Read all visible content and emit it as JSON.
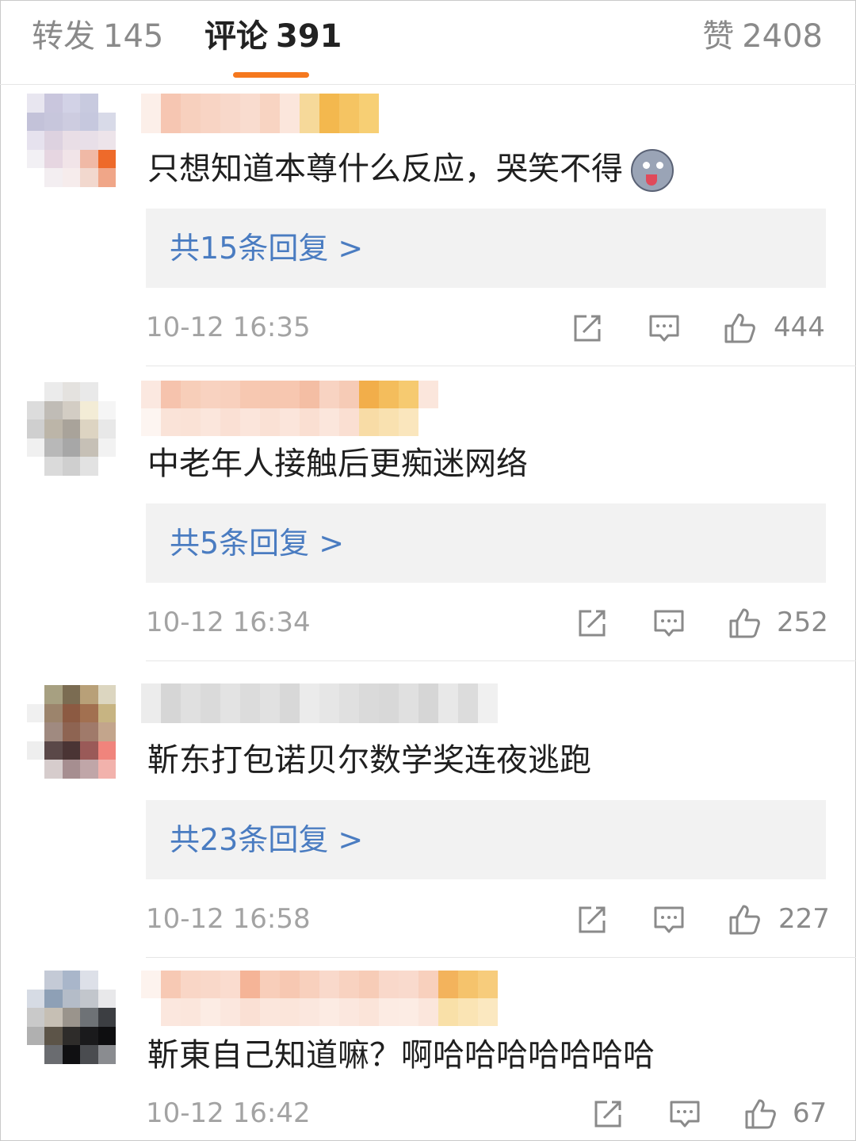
{
  "tabs": {
    "reposts": {
      "label": "转发",
      "count": "145"
    },
    "comments": {
      "label": "评论",
      "count": "391"
    },
    "likes": {
      "label": "赞",
      "count": "2408"
    }
  },
  "accent_color": "#f5781e",
  "link_color": "#4a7cc1",
  "comments": [
    {
      "text": "只想知道本尊什么反应，哭笑不得",
      "has_emoji": true,
      "emoji": "husky-dog-emoji",
      "replies": "共15条回复 >",
      "time": "10-12 16:35",
      "likes": "444"
    },
    {
      "text": "中老年人接触后更痴迷网络",
      "replies": "共5条回复 >",
      "time": "10-12 16:34",
      "likes": "252"
    },
    {
      "text": "靳东打包诺贝尔数学奖连夜逃跑",
      "replies": "共23条回复 >",
      "time": "10-12 16:58",
      "likes": "227"
    },
    {
      "text": "靳東自己知道嘛？啊哈哈哈哈哈哈哈",
      "time": "10-12 16:42",
      "likes": "67"
    }
  ],
  "icons": [
    "share-icon",
    "comment-icon",
    "thumbs-up-icon"
  ]
}
